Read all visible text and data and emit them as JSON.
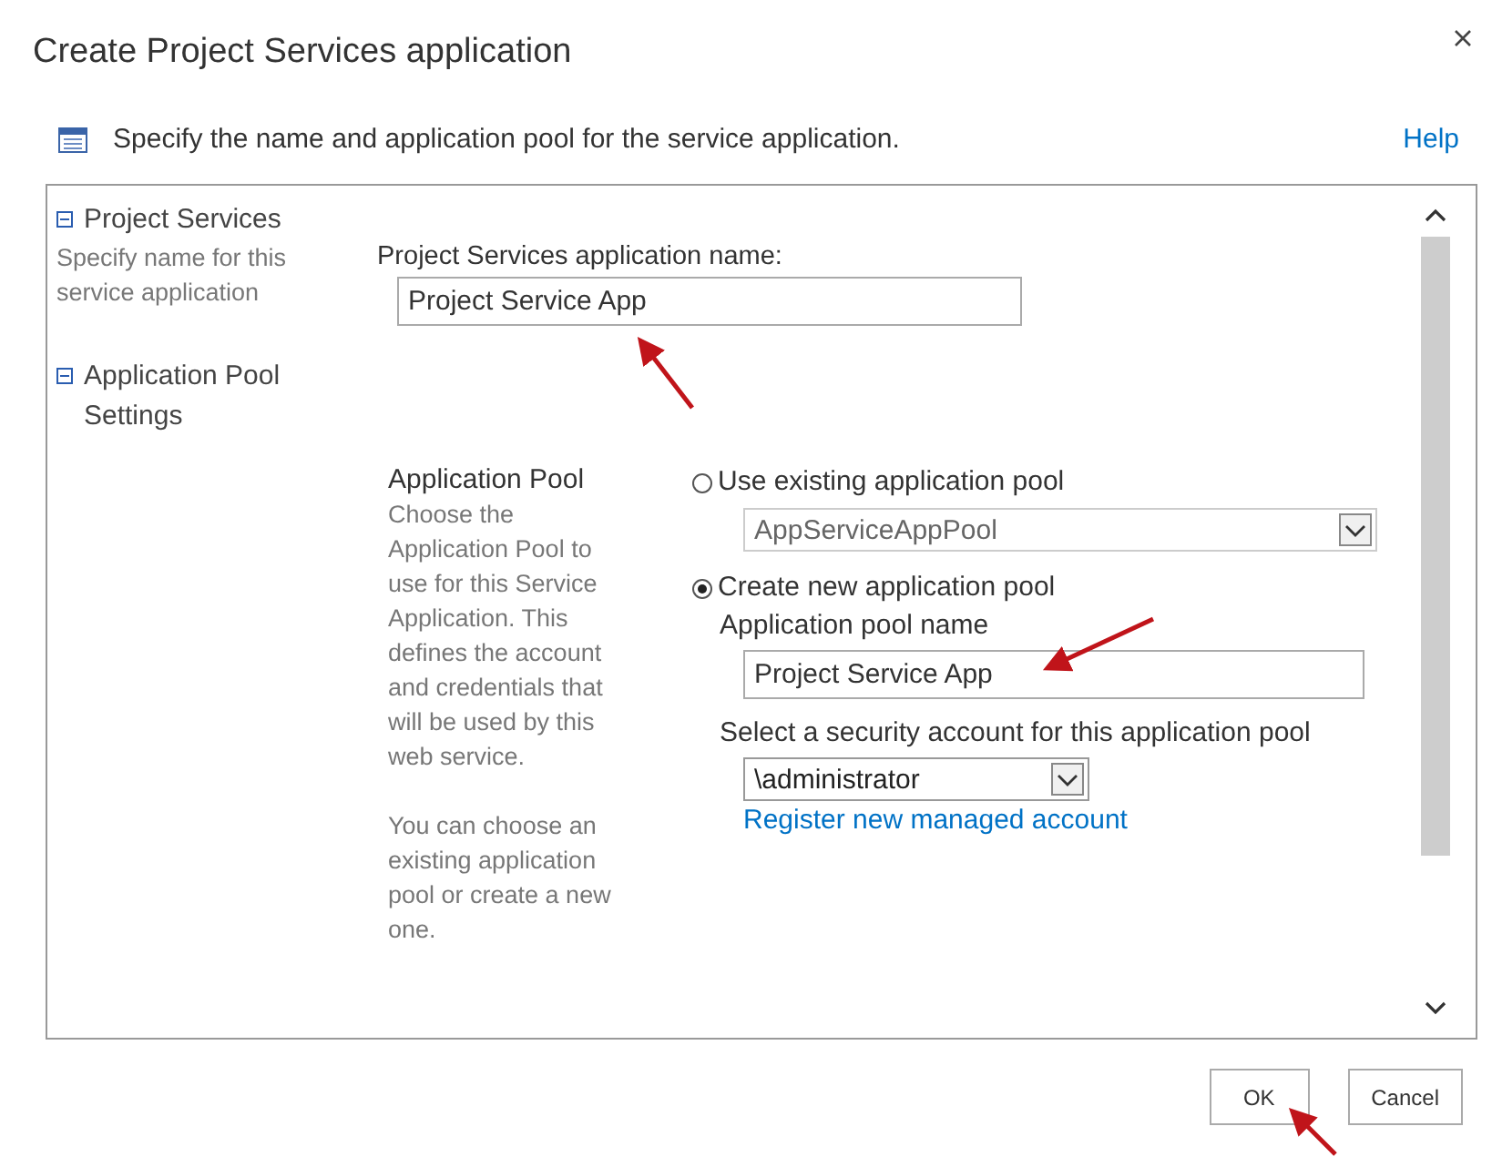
{
  "dialog": {
    "title": "Create Project Services application"
  },
  "header": {
    "text": "Specify the name and application pool for the service application.",
    "help": "Help"
  },
  "sections": [
    {
      "heading": "Project Services",
      "expanded": true,
      "description": "Specify name for this service application"
    },
    {
      "heading": "Application Pool Settings",
      "expanded": true
    }
  ],
  "app_name": {
    "label": "Project Services application name:",
    "value": "Project Service App"
  },
  "app_pool": {
    "heading": "Application Pool",
    "description": [
      "Choose the Application Pool to use for this Service Application.  This defines the account and credentials that will be used by this web service.",
      "You can choose an existing application pool or create a new one."
    ]
  },
  "pool_options": [
    {
      "label": "Use existing application pool",
      "selected": false
    },
    {
      "label": "Create new application pool",
      "selected": true
    }
  ],
  "existing_pool": {
    "value": "AppServiceAppPool",
    "disabled": true
  },
  "new_pool": {
    "label": "Application pool name",
    "value": "Project Service App"
  },
  "security": {
    "label": "Select a security account for this application pool",
    "value": "\\administrator",
    "link": "Register new managed account"
  },
  "buttons": [
    {
      "label": "OK"
    },
    {
      "label": "Cancel"
    }
  ]
}
